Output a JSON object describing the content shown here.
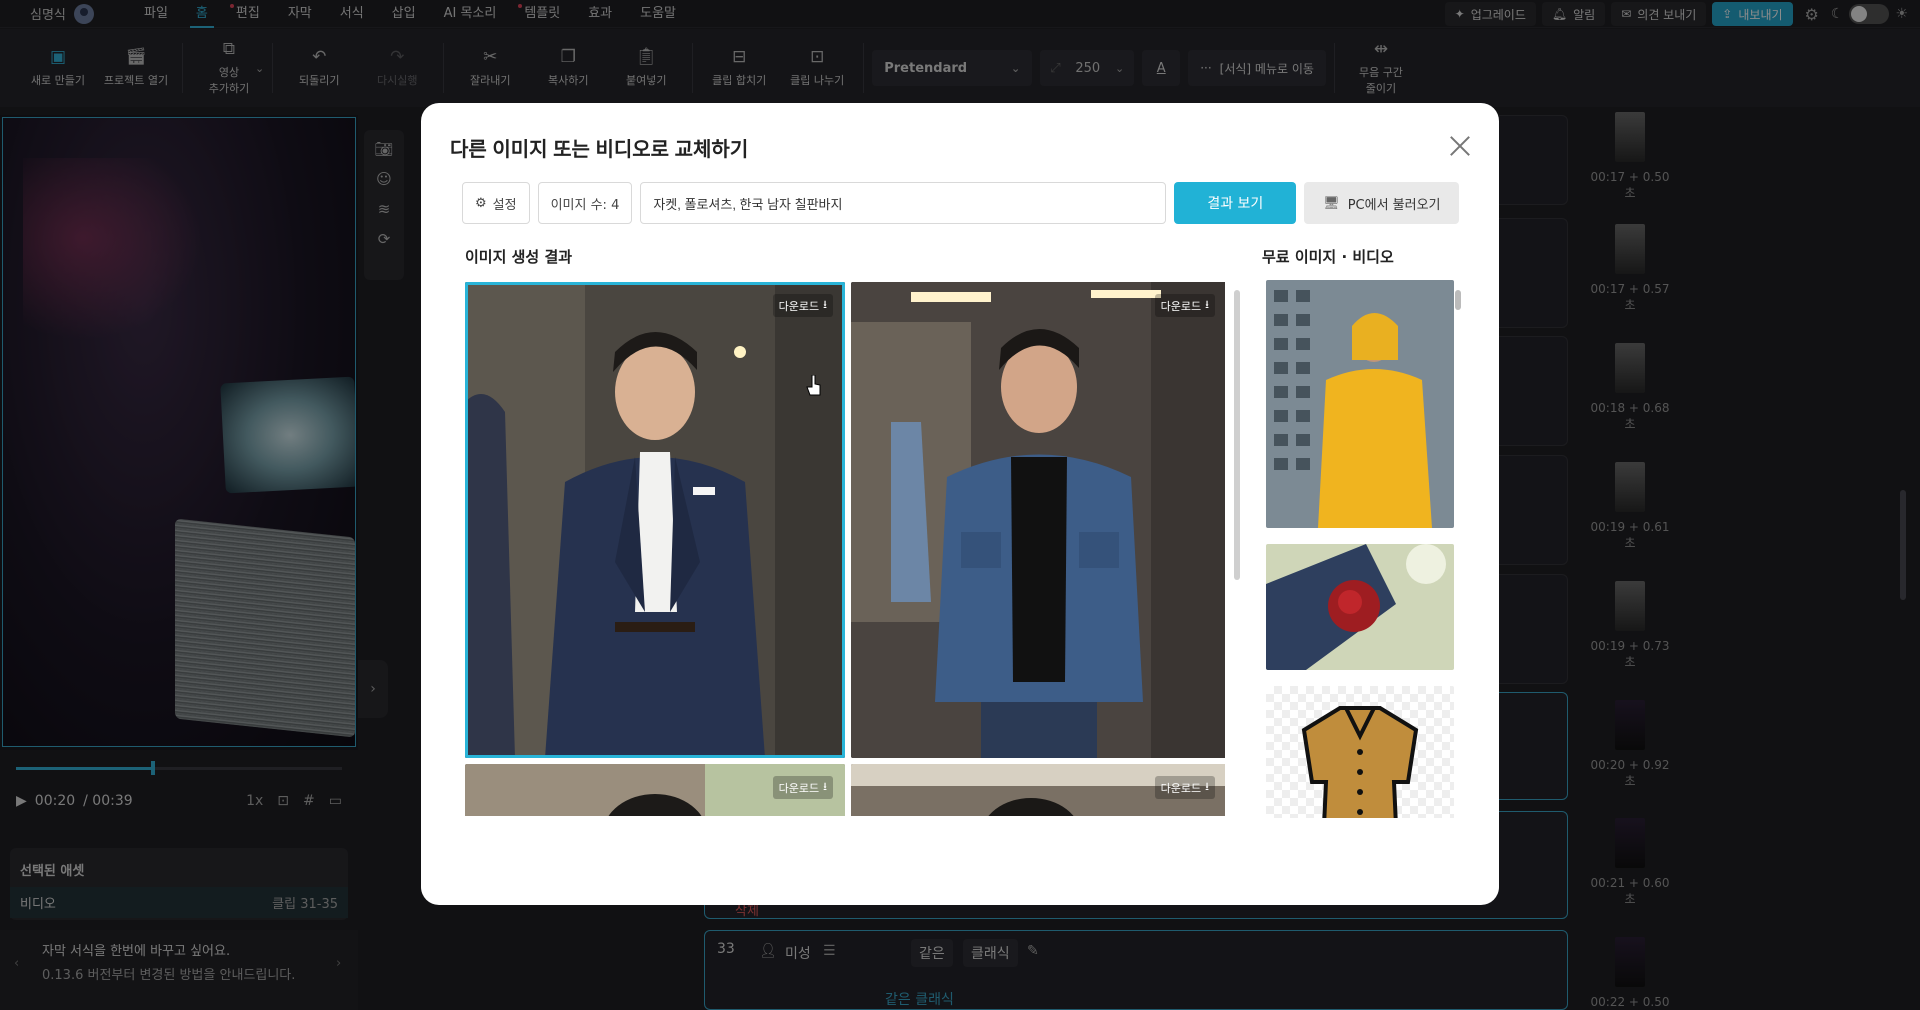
{
  "menubar": {
    "user_name": "심명식",
    "items": [
      {
        "label": "파일",
        "dot": false,
        "active": false
      },
      {
        "label": "홈",
        "dot": false,
        "active": true
      },
      {
        "label": "편집",
        "dot": true,
        "active": false
      },
      {
        "label": "자막",
        "dot": false,
        "active": false
      },
      {
        "label": "서식",
        "dot": false,
        "active": false
      },
      {
        "label": "삽입",
        "dot": false,
        "active": false
      },
      {
        "label": "AI 목소리",
        "dot": false,
        "active": false
      },
      {
        "label": "템플릿",
        "dot": true,
        "active": false
      },
      {
        "label": "효과",
        "dot": false,
        "active": false
      },
      {
        "label": "도움말",
        "dot": false,
        "active": false
      }
    ],
    "upgrade": "업그레이드",
    "alerts": "알림",
    "feedback": "의견 보내기",
    "export": "내보내기"
  },
  "toolbar": {
    "new": "새로 만들기",
    "open": "프로젝트 열기",
    "add_video_1": "영상",
    "add_video_2": "추가하기",
    "undo": "되돌리기",
    "redo": "다시실행",
    "cut": "잘라내기",
    "copy": "복사하기",
    "paste": "붙여넣기",
    "merge": "클립 합치기",
    "split": "클립 나누기",
    "font": "Pretendard",
    "size": "250",
    "color_glyph": "A",
    "format_menu": "[서식] 메뉴로 이동",
    "silence_1": "무음 구간",
    "silence_2": "줄이기"
  },
  "player": {
    "current": "00:20",
    "total": "/ 00:39",
    "speed": "1x",
    "progress": 0.42
  },
  "assets": {
    "title": "선택된 애셋",
    "item": "비디오",
    "clip": "클립 31-35"
  },
  "tip": {
    "line1": "자막 서식을 한번에 바꾸고 싶어요.",
    "line2": "0.13.6 버전부터 변경된 방법을 안내드립니다."
  },
  "timeline": {
    "thumbs": [
      "00:17 + 0.50초",
      "00:17 + 0.57초",
      "00:18 + 0.68초",
      "00:19 + 0.61초",
      "00:19 + 0.73초",
      "00:20 + 0.92초",
      "00:21 + 0.60초",
      "00:22 + 0.50초"
    ],
    "row_number": "33",
    "speaker": "미성",
    "tag1": "같은",
    "tag2": "클래식",
    "sub_text": "같은 클래식",
    "delete_label": "삭제"
  },
  "modal": {
    "title": "다른 이미지 또는 비디오로 교체하기",
    "settings": "설정",
    "count": "이미지 수: 4",
    "prompt_value": "자켓, 폴로셔츠, 한국 남자 칠판바지",
    "search": "결과 보기",
    "from_pc": "PC에서 불러오기",
    "results_heading": "이미지 생성 결과",
    "free_heading": "무료 이미지 · 비디오",
    "download": "다운로드"
  },
  "colors": {
    "accent": "#21b2d6",
    "menu_accent": "#33b3d9",
    "selection": "#29b4d8"
  }
}
